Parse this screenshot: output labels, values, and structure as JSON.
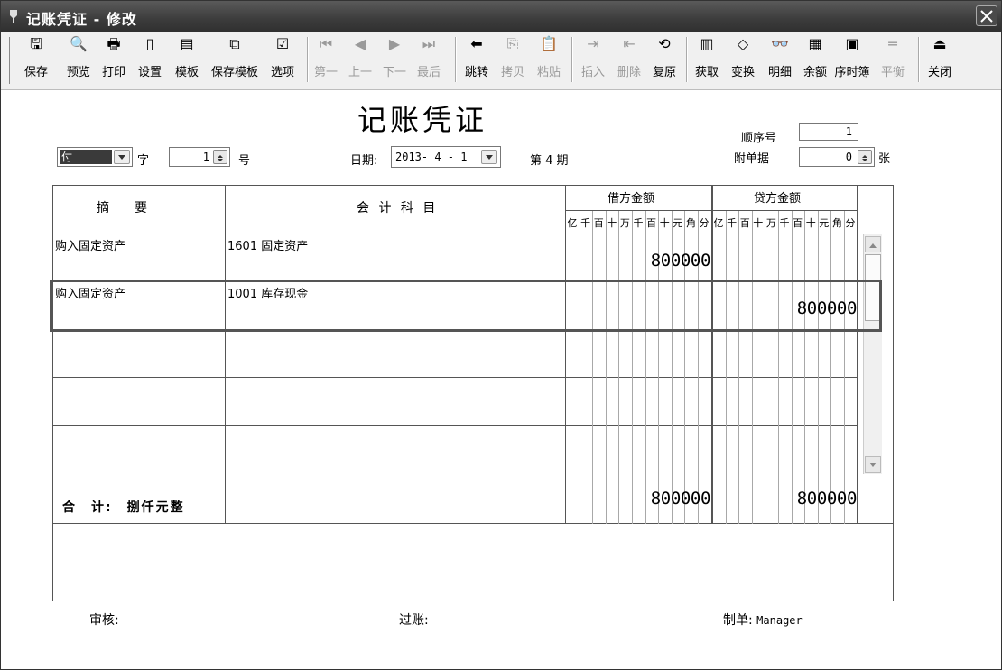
{
  "window": {
    "title": "记账凭证 - 修改"
  },
  "toolbar": {
    "buttons": [
      {
        "label": "保存",
        "icon": "save-icon",
        "glyph": "🖫",
        "enabled": true
      },
      {
        "label": "预览",
        "icon": "preview-icon",
        "glyph": "🔍",
        "enabled": true
      },
      {
        "label": "打印",
        "icon": "print-icon",
        "glyph": "🖶",
        "enabled": true
      },
      {
        "label": "设置",
        "icon": "page-setup-icon",
        "glyph": "▯",
        "enabled": true
      },
      {
        "label": "模板",
        "icon": "template-icon",
        "glyph": "▤",
        "enabled": true
      },
      {
        "label": "保存模板",
        "icon": "save-template-icon",
        "glyph": "⧉",
        "enabled": true
      },
      {
        "label": "选项",
        "icon": "options-icon",
        "glyph": "☑",
        "enabled": true
      },
      {
        "label": "第一",
        "icon": "first-icon",
        "glyph": "⏮",
        "enabled": false
      },
      {
        "label": "上一",
        "icon": "prev-icon",
        "glyph": "◀",
        "enabled": false
      },
      {
        "label": "下一",
        "icon": "next-icon",
        "glyph": "▶",
        "enabled": false
      },
      {
        "label": "最后",
        "icon": "last-icon",
        "glyph": "⏭",
        "enabled": false
      },
      {
        "label": "跳转",
        "icon": "jump-icon",
        "glyph": "⬅",
        "enabled": true
      },
      {
        "label": "拷贝",
        "icon": "copy-icon",
        "glyph": "⎘",
        "enabled": false
      },
      {
        "label": "粘贴",
        "icon": "paste-icon",
        "glyph": "📋",
        "enabled": false
      },
      {
        "label": "插入",
        "icon": "insert-icon",
        "glyph": "⇥",
        "enabled": false
      },
      {
        "label": "删除",
        "icon": "delete-icon",
        "glyph": "⇤",
        "enabled": false
      },
      {
        "label": "复原",
        "icon": "restore-icon",
        "glyph": "⟲",
        "enabled": true
      },
      {
        "label": "获取",
        "icon": "fetch-icon",
        "glyph": "▥",
        "enabled": true
      },
      {
        "label": "变换",
        "icon": "transform-icon",
        "glyph": "◇",
        "enabled": true
      },
      {
        "label": "明细",
        "icon": "detail-icon",
        "glyph": "👓",
        "enabled": true
      },
      {
        "label": "余额",
        "icon": "balance-icon",
        "glyph": "▦",
        "enabled": true
      },
      {
        "label": "序时簿",
        "icon": "journal-icon",
        "glyph": "▣",
        "enabled": true
      },
      {
        "label": "平衡",
        "icon": "balance-check-icon",
        "glyph": "═",
        "enabled": false
      },
      {
        "label": "关闭",
        "icon": "exit-icon",
        "glyph": "⏏",
        "enabled": true
      }
    ]
  },
  "voucher": {
    "title": "记账凭证",
    "seq_label": "顺序号",
    "seq_value": "1",
    "type_value": "付",
    "type_suffix": "字",
    "number_value": "1",
    "number_suffix": "号",
    "date_label": "日期:",
    "date_value": "2013- 4 - 1",
    "period_text": "第 4 期",
    "attachments_label": "附单据",
    "attachments_value": "0",
    "attachments_unit": "张"
  },
  "table": {
    "headers": {
      "summary": "摘　　要",
      "account": "会 计 科 目",
      "debit": "借方金额",
      "credit": "贷方金额"
    },
    "digit_units": [
      "亿",
      "千",
      "百",
      "十",
      "万",
      "千",
      "百",
      "十",
      "元",
      "角",
      "分"
    ],
    "rows": [
      {
        "summary": "购入固定资产",
        "account": "1601 固定资产",
        "debit": "800000",
        "credit": ""
      },
      {
        "summary": "购入固定资产",
        "account": "1001 库存现金",
        "debit": "",
        "credit": "800000"
      },
      {
        "summary": "",
        "account": "",
        "debit": "",
        "credit": ""
      },
      {
        "summary": "",
        "account": "",
        "debit": "",
        "credit": ""
      },
      {
        "summary": "",
        "account": "",
        "debit": "",
        "credit": ""
      }
    ],
    "total_label": "合　计:　捌仟元整",
    "total_debit": "800000",
    "total_credit": "800000"
  },
  "footer": {
    "reviewer_label": "审核:",
    "posting_label": "过账:",
    "maker_label": "制单:",
    "maker_value": "Manager"
  }
}
